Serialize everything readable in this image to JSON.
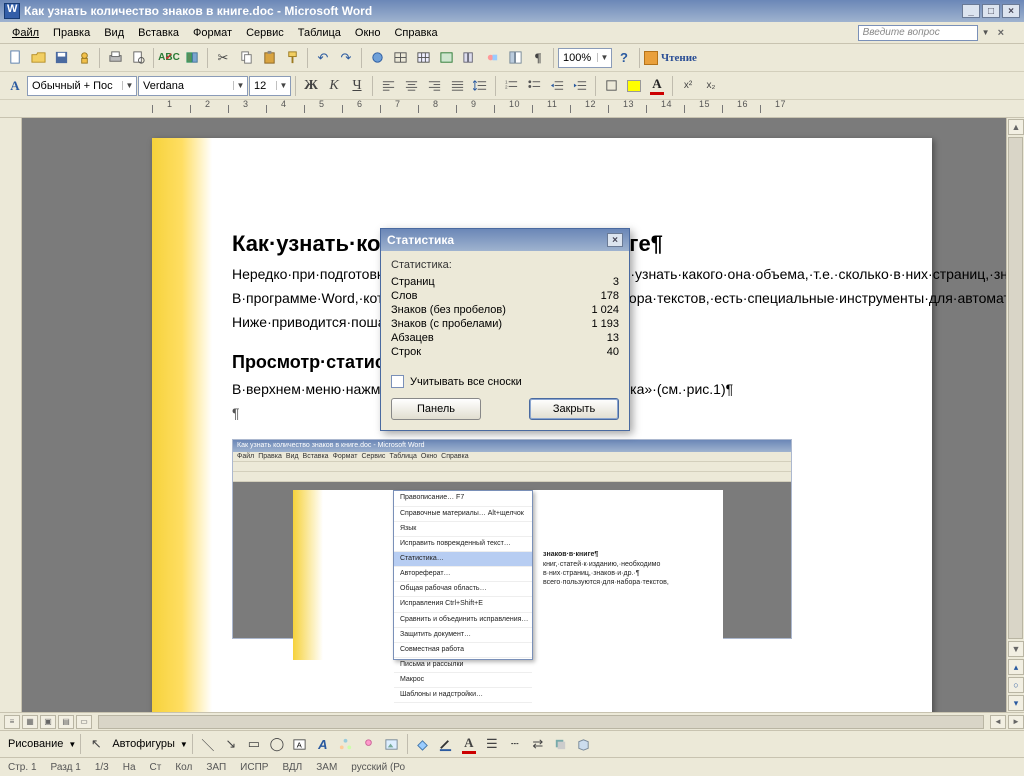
{
  "window": {
    "title": "Как узнать количество знаков в книге.doc - Microsoft Word"
  },
  "menu": {
    "file": "Файл",
    "edit": "Правка",
    "view": "Вид",
    "insert": "Вставка",
    "format": "Формат",
    "tools": "Сервис",
    "table": "Таблица",
    "window": "Окно",
    "help": "Справка",
    "ask_placeholder": "Введите вопрос"
  },
  "toolbar1": {
    "zoom": "100%",
    "read_label": "Чтение"
  },
  "toolbar2": {
    "style_handle": "A",
    "style": "Обычный + Пос",
    "font": "Verdana",
    "size": "12",
    "bold": "Ж",
    "italic": "К",
    "underline": "Ч"
  },
  "document": {
    "h1": "Как·узнать·количество·знаков·в·книге¶",
    "p1": "Нередко·при·подготовке·книг,·статей·к·изданию,·необходимо·узнать·какого·она·объема,·т.е.·сколько·в·них·страниц,·знаков·и·др.·¶",
    "p2": "В·программе·Word,·которой·чаще·всего·пользуются·для·набора·текстов,·есть·специальные·инструменты·для·автоматического·получения·подобных·сведений.·¶",
    "p3": "Ниже·приводится·пошаговая·иллюстрация·как·это·делать.¶",
    "h2": "Просмотр·статистики¶",
    "p4": "В·верхнем·меню·нажмите·на·«Сервис»,·а·затем·-·«Статистика»·(см.·рис.1)¶",
    "p5": "¶"
  },
  "dialog": {
    "title": "Статистика",
    "section": "Статистика:",
    "rows": {
      "pages_l": "Страниц",
      "pages_v": "3",
      "words_l": "Слов",
      "words_v": "178",
      "chars_nosp_l": "Знаков (без пробелов)",
      "chars_nosp_v": "1 024",
      "chars_sp_l": "Знаков (с пробелами)",
      "chars_sp_v": "1 193",
      "paras_l": "Абзацев",
      "paras_v": "13",
      "lines_l": "Строк",
      "lines_v": "40"
    },
    "checkbox": "Учитывать все сноски",
    "btn_panel": "Панель",
    "btn_close": "Закрыть"
  },
  "mini_menu": {
    "i0": "Правописание…                F7",
    "i1": "Справочные материалы…   Alt+щелчок",
    "i2": "Язык",
    "i3": "Исправить поврежденный текст…",
    "i4": "Статистика…",
    "i5": "Автореферат…",
    "i6": "Общая рабочая область…",
    "i7": "Исправления         Ctrl+Shift+E",
    "i8": "Сравнить и объединить исправления…",
    "i9": "Защитить документ…",
    "i10": "Совместная работа",
    "i11": "Письма и рассылки",
    "i12": "Макрос",
    "i13": "Шаблоны и надстройки…"
  },
  "mini_text": {
    "h": "знаков·в·книге¶",
    "t1": "книг,·статей·к·изданию,·необходимо",
    "t2": "в·них·страниц,·знаков·и·др.·¶",
    "t3": "всего·пользуются·для·набора·текстов,"
  },
  "draw": {
    "label": "Рисование",
    "autoshapes": "Автофигуры"
  },
  "status": {
    "page_l": "Стр.",
    "page_v": "1",
    "sec_l": "Разд",
    "sec_v": "1",
    "pages": "1/3",
    "at": "На",
    "ln": "Ст",
    "col": "Кол",
    "rec": "ЗАП",
    "trk": "ИСПР",
    "ext": "ВДЛ",
    "ovr": "ЗАМ",
    "lang": "русский (Ро"
  }
}
